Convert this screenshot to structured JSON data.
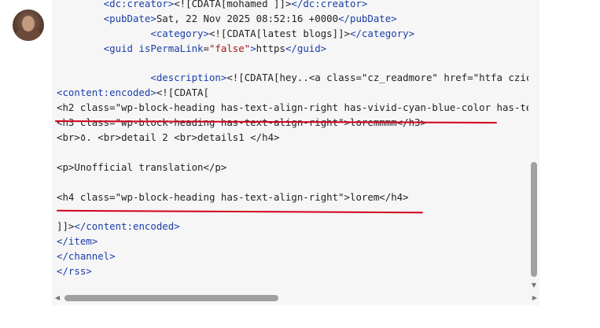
{
  "user": {
    "avatar_alt": "user avatar"
  },
  "code_lines": [
    [
      {
        "t": "tag",
        "s": "        <dc:creator>"
      },
      {
        "t": "txt",
        "s": "<![CDATA[mohamed ]]>"
      },
      {
        "t": "tag",
        "s": "</dc:creator>"
      }
    ],
    [
      {
        "t": "tag",
        "s": "        <pubDate>"
      },
      {
        "t": "txt",
        "s": "Sat, 22 Nov 2025 08:52:16 +0000"
      },
      {
        "t": "tag",
        "s": "</pubDate>"
      }
    ],
    [
      {
        "t": "tag",
        "s": "                <category>"
      },
      {
        "t": "txt",
        "s": "<![CDATA[latest blogs]]>"
      },
      {
        "t": "tag",
        "s": "</category>"
      }
    ],
    [
      {
        "t": "tag",
        "s": "        <guid "
      },
      {
        "t": "attr",
        "s": "isPermaLink"
      },
      {
        "t": "txt",
        "s": "="
      },
      {
        "t": "str",
        "s": "\"false\""
      },
      {
        "t": "tag",
        "s": ">"
      },
      {
        "t": "txt",
        "s": "https"
      },
      {
        "t": "tag",
        "s": "</guid>"
      }
    ],
    [
      {
        "t": "txt",
        "s": ""
      }
    ],
    [
      {
        "t": "tag",
        "s": "                <description>"
      },
      {
        "t": "txt",
        "s": "<![CDATA[hey..<a class=\"cz_readmore\" href=\"htfa czic"
      }
    ],
    [
      {
        "t": "tag",
        "s": "<content:encoded>"
      },
      {
        "t": "txt",
        "s": "<![CDATA["
      }
    ],
    [
      {
        "t": "txt",
        "s": "<h2 class=\"wp-block-heading has-text-align-right has-vivid-cyan-blue-color has-te"
      }
    ],
    [
      {
        "t": "txt",
        "s": "<h3 class=\"wp-block-heading has-text-align-right\">loremmmm</h3>"
      }
    ],
    [
      {
        "t": "txt",
        "s": "<br>٥. <br>detail 2 <br>details1 </h4>"
      }
    ],
    [
      {
        "t": "txt",
        "s": ""
      }
    ],
    [
      {
        "t": "txt",
        "s": "<p>Unofficial translation</p>"
      }
    ],
    [
      {
        "t": "txt",
        "s": ""
      }
    ],
    [
      {
        "t": "txt",
        "s": "<h4 class=\"wp-block-heading has-text-align-right\">lorem</h4>"
      }
    ],
    [
      {
        "t": "txt",
        "s": ""
      }
    ],
    [
      {
        "t": "txt",
        "s": "]]>"
      },
      {
        "t": "tag",
        "s": "</content:encoded>"
      }
    ],
    [
      {
        "t": "tag",
        "s": "</item>"
      }
    ],
    [
      {
        "t": "tag",
        "s": "</channel>"
      }
    ],
    [
      {
        "t": "tag",
        "s": "</rss>"
      }
    ]
  ],
  "annotations": {
    "color": "#d0021b",
    "underlined_lines": [
      7,
      13
    ]
  },
  "icons": {
    "scroll_up": "▲",
    "scroll_down": "▼",
    "scroll_left": "◀",
    "scroll_right": "▶"
  }
}
